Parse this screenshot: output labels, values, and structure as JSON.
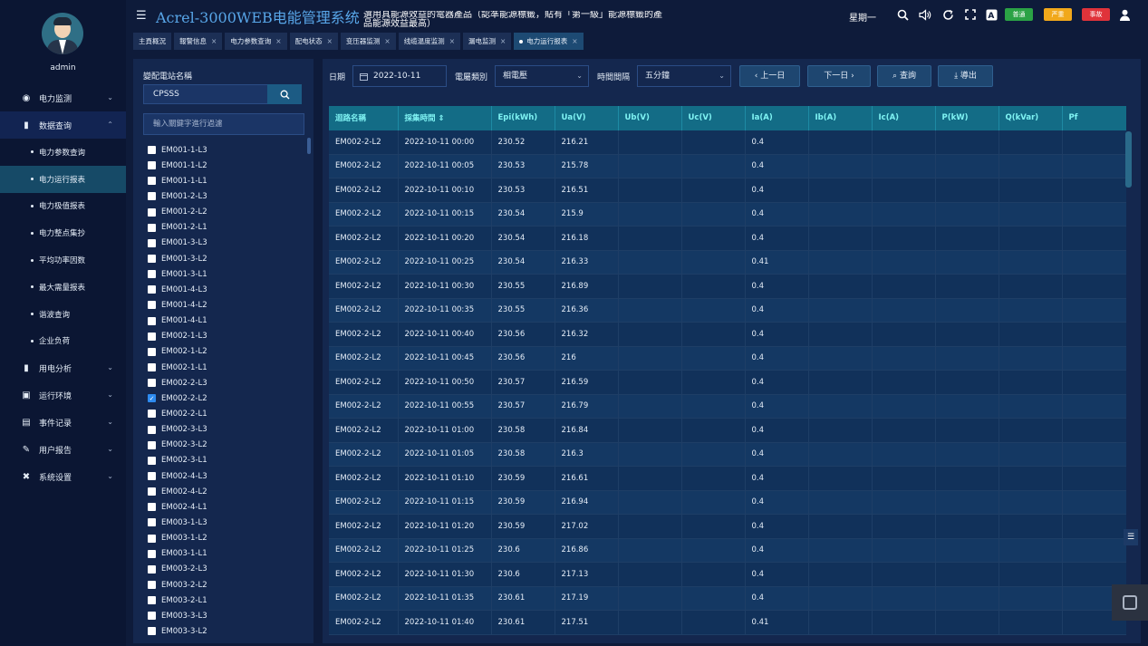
{
  "user": {
    "name": "admin"
  },
  "header": {
    "title": "Acrel-3000WEB电能管理系统",
    "slogan": "選用具能源效益的電器產品（認準能源標籤，貼有「第一級」能源標籤的產品能源效益最高）",
    "weekday": "星期一",
    "badges": {
      "normal": "普通",
      "serious": "严重",
      "accident": "事故"
    },
    "colors": {
      "normal": "#2ba245",
      "serious": "#f1a81b",
      "accident": "#e0333a",
      "title": "#58a6e8"
    }
  },
  "sidebar": {
    "items": [
      {
        "label": "电力监测",
        "icon": "dashboard-icon",
        "glyph": "◉"
      },
      {
        "label": "数据查询",
        "icon": "bar-chart-icon",
        "glyph": "▮"
      },
      {
        "label": "用电分析",
        "icon": "bar-chart-icon",
        "glyph": "▮"
      },
      {
        "label": "运行环境",
        "icon": "monitor-icon",
        "glyph": "▣"
      },
      {
        "label": "事件记录",
        "icon": "calendar-icon",
        "glyph": "▤"
      },
      {
        "label": "用户报告",
        "icon": "edit-icon",
        "glyph": "✎"
      },
      {
        "label": "系统设置",
        "icon": "tools-icon",
        "glyph": "✖"
      }
    ],
    "subitems": [
      "电力参数查询",
      "电力运行报表",
      "电力极值报表",
      "电力整点集抄",
      "平均功率因数",
      "最大需量报表",
      "谐波查询",
      "企业负荷"
    ]
  },
  "tabs": [
    "主頁概況",
    "報警信息",
    "电力参数查询",
    "配电状态",
    "变压器监测",
    "线缆温度监测",
    "漏电监测",
    "电力运行报表"
  ],
  "station": {
    "title": "變配電站名稱",
    "search_value": "CPSSS",
    "filter_placeholder": "輸入關鍵字進行過濾",
    "items": [
      "EM001-1-L3",
      "EM001-1-L2",
      "EM001-1-L1",
      "EM001-2-L3",
      "EM001-2-L2",
      "EM001-2-L1",
      "EM001-3-L3",
      "EM001-3-L2",
      "EM001-3-L1",
      "EM001-4-L3",
      "EM001-4-L2",
      "EM001-4-L1",
      "EM002-1-L3",
      "EM002-1-L2",
      "EM002-1-L1",
      "EM002-2-L3",
      "EM002-2-L2",
      "EM002-2-L1",
      "EM002-3-L3",
      "EM002-3-L2",
      "EM002-3-L1",
      "EM002-4-L3",
      "EM002-4-L2",
      "EM002-4-L1",
      "EM003-1-L3",
      "EM003-1-L2",
      "EM003-1-L1",
      "EM003-2-L3",
      "EM003-2-L2",
      "EM003-2-L1",
      "EM003-3-L3",
      "EM003-3-L2"
    ],
    "checked": "EM002-2-L2"
  },
  "filters": {
    "date_label": "日期",
    "date_value": "2022-10-11",
    "type_label": "電屬類別",
    "type_value": "相電壓",
    "interval_label": "時間間隔",
    "interval_value": "五分鐘",
    "prev_label": "上一日",
    "next_label": "下一日",
    "query_label": "查詢",
    "export_label": "導出"
  },
  "table": {
    "headers": [
      "迴路名稱",
      "採集時間",
      "Epi(kWh)",
      "Ua(V)",
      "Ub(V)",
      "Uc(V)",
      "Ia(A)",
      "Ib(A)",
      "Ic(A)",
      "P(kW)",
      "Q(kVar)",
      "Pf"
    ],
    "rows": [
      [
        "EM002-2-L2",
        "2022-10-11 00:00",
        "230.52",
        "216.21",
        "",
        "",
        "0.4",
        "",
        "",
        "",
        "",
        ""
      ],
      [
        "EM002-2-L2",
        "2022-10-11 00:05",
        "230.53",
        "215.78",
        "",
        "",
        "0.4",
        "",
        "",
        "",
        "",
        ""
      ],
      [
        "EM002-2-L2",
        "2022-10-11 00:10",
        "230.53",
        "216.51",
        "",
        "",
        "0.4",
        "",
        "",
        "",
        "",
        ""
      ],
      [
        "EM002-2-L2",
        "2022-10-11 00:15",
        "230.54",
        "215.9",
        "",
        "",
        "0.4",
        "",
        "",
        "",
        "",
        ""
      ],
      [
        "EM002-2-L2",
        "2022-10-11 00:20",
        "230.54",
        "216.18",
        "",
        "",
        "0.4",
        "",
        "",
        "",
        "",
        ""
      ],
      [
        "EM002-2-L2",
        "2022-10-11 00:25",
        "230.54",
        "216.33",
        "",
        "",
        "0.41",
        "",
        "",
        "",
        "",
        ""
      ],
      [
        "EM002-2-L2",
        "2022-10-11 00:30",
        "230.55",
        "216.89",
        "",
        "",
        "0.4",
        "",
        "",
        "",
        "",
        ""
      ],
      [
        "EM002-2-L2",
        "2022-10-11 00:35",
        "230.55",
        "216.36",
        "",
        "",
        "0.4",
        "",
        "",
        "",
        "",
        ""
      ],
      [
        "EM002-2-L2",
        "2022-10-11 00:40",
        "230.56",
        "216.32",
        "",
        "",
        "0.4",
        "",
        "",
        "",
        "",
        ""
      ],
      [
        "EM002-2-L2",
        "2022-10-11 00:45",
        "230.56",
        "216",
        "",
        "",
        "0.4",
        "",
        "",
        "",
        "",
        ""
      ],
      [
        "EM002-2-L2",
        "2022-10-11 00:50",
        "230.57",
        "216.59",
        "",
        "",
        "0.4",
        "",
        "",
        "",
        "",
        ""
      ],
      [
        "EM002-2-L2",
        "2022-10-11 00:55",
        "230.57",
        "216.79",
        "",
        "",
        "0.4",
        "",
        "",
        "",
        "",
        ""
      ],
      [
        "EM002-2-L2",
        "2022-10-11 01:00",
        "230.58",
        "216.84",
        "",
        "",
        "0.4",
        "",
        "",
        "",
        "",
        ""
      ],
      [
        "EM002-2-L2",
        "2022-10-11 01:05",
        "230.58",
        "216.3",
        "",
        "",
        "0.4",
        "",
        "",
        "",
        "",
        ""
      ],
      [
        "EM002-2-L2",
        "2022-10-11 01:10",
        "230.59",
        "216.61",
        "",
        "",
        "0.4",
        "",
        "",
        "",
        "",
        ""
      ],
      [
        "EM002-2-L2",
        "2022-10-11 01:15",
        "230.59",
        "216.94",
        "",
        "",
        "0.4",
        "",
        "",
        "",
        "",
        ""
      ],
      [
        "EM002-2-L2",
        "2022-10-11 01:20",
        "230.59",
        "217.02",
        "",
        "",
        "0.4",
        "",
        "",
        "",
        "",
        ""
      ],
      [
        "EM002-2-L2",
        "2022-10-11 01:25",
        "230.6",
        "216.86",
        "",
        "",
        "0.4",
        "",
        "",
        "",
        "",
        ""
      ],
      [
        "EM002-2-L2",
        "2022-10-11 01:30",
        "230.6",
        "217.13",
        "",
        "",
        "0.4",
        "",
        "",
        "",
        "",
        ""
      ],
      [
        "EM002-2-L2",
        "2022-10-11 01:35",
        "230.61",
        "217.19",
        "",
        "",
        "0.4",
        "",
        "",
        "",
        "",
        ""
      ],
      [
        "EM002-2-L2",
        "2022-10-11 01:40",
        "230.61",
        "217.51",
        "",
        "",
        "0.41",
        "",
        "",
        "",
        "",
        ""
      ]
    ]
  }
}
